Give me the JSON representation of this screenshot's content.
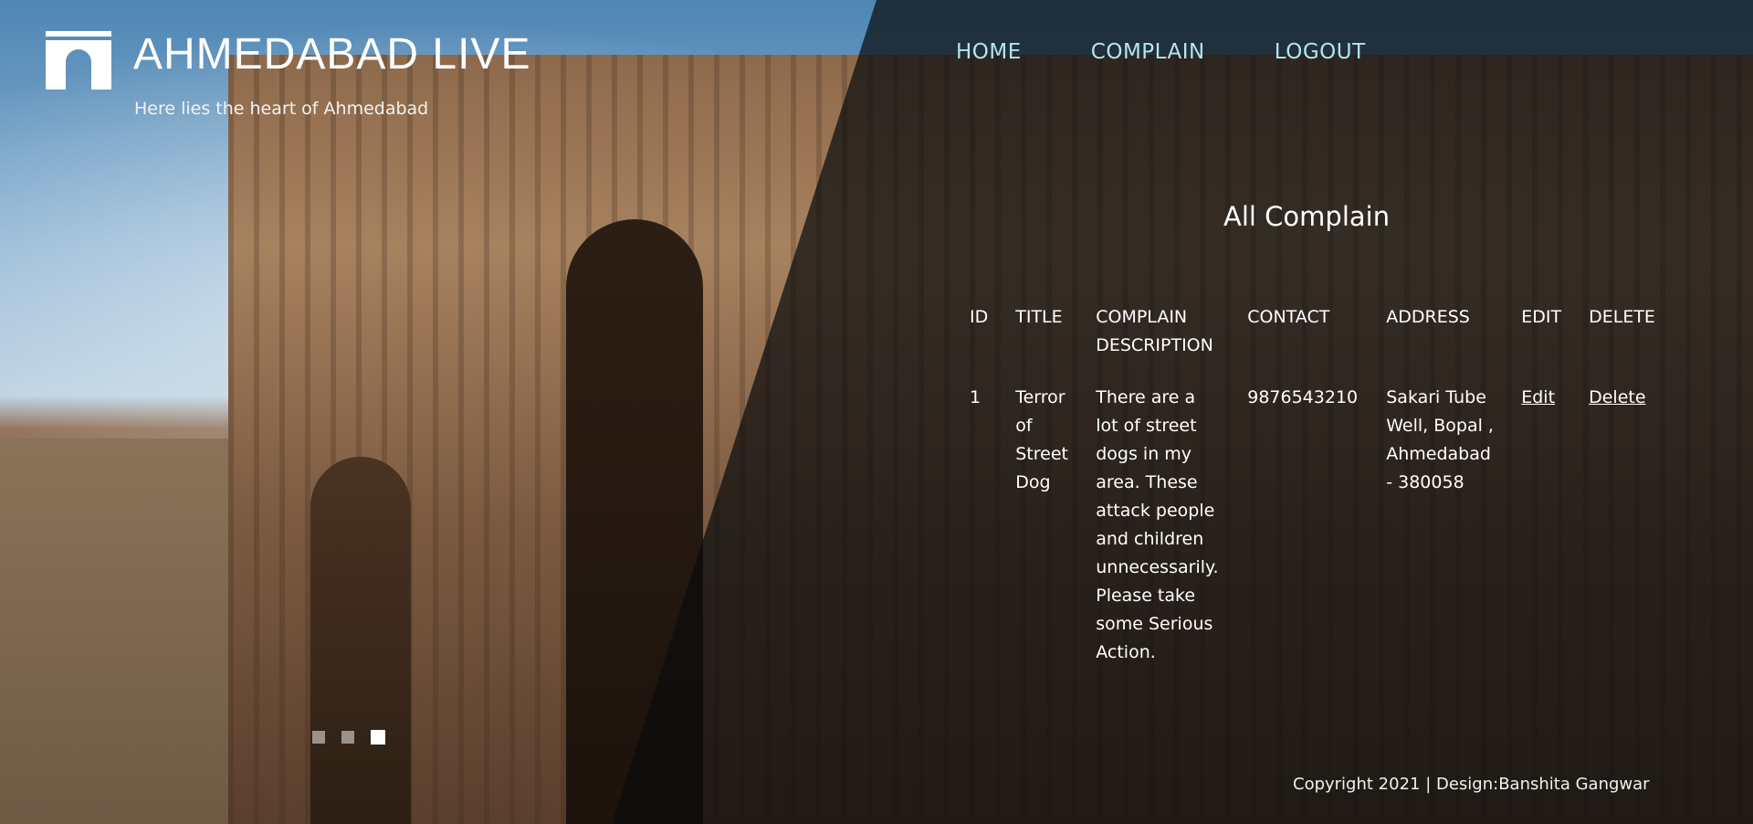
{
  "site": {
    "title": "AHMEDABAD LIVE",
    "tagline": "Here lies the heart of Ahmedabad",
    "logo_icon": "gate-icon"
  },
  "nav": {
    "items": [
      {
        "label": "HOME"
      },
      {
        "label": "COMPLAIN"
      },
      {
        "label": "LOGOUT"
      }
    ]
  },
  "main": {
    "section_title": "All Complain",
    "table": {
      "headers": [
        "ID",
        "TITLE",
        "COMPLAIN DESCRIPTION",
        "CONTACT",
        "ADDRESS",
        "EDIT",
        "DELETE"
      ],
      "rows": [
        {
          "id": "1",
          "title": "Terror of Street Dog",
          "description": "There are a lot of street dogs in my area. These attack people and children unnecessarily. Please take some Serious Action.",
          "contact": "9876543210",
          "address": "Sakari Tube Well, Bopal , Ahmedabad - 380058",
          "edit_label": "Edit",
          "delete_label": "Delete"
        }
      ]
    }
  },
  "slider": {
    "dot_count": 3,
    "active_index": 2
  },
  "footer": {
    "text": "Copyright 2021 | Design:Banshita Gangwar"
  },
  "colors": {
    "nav_link": "#b7e3ee",
    "overlay": "#0a0c0e"
  }
}
